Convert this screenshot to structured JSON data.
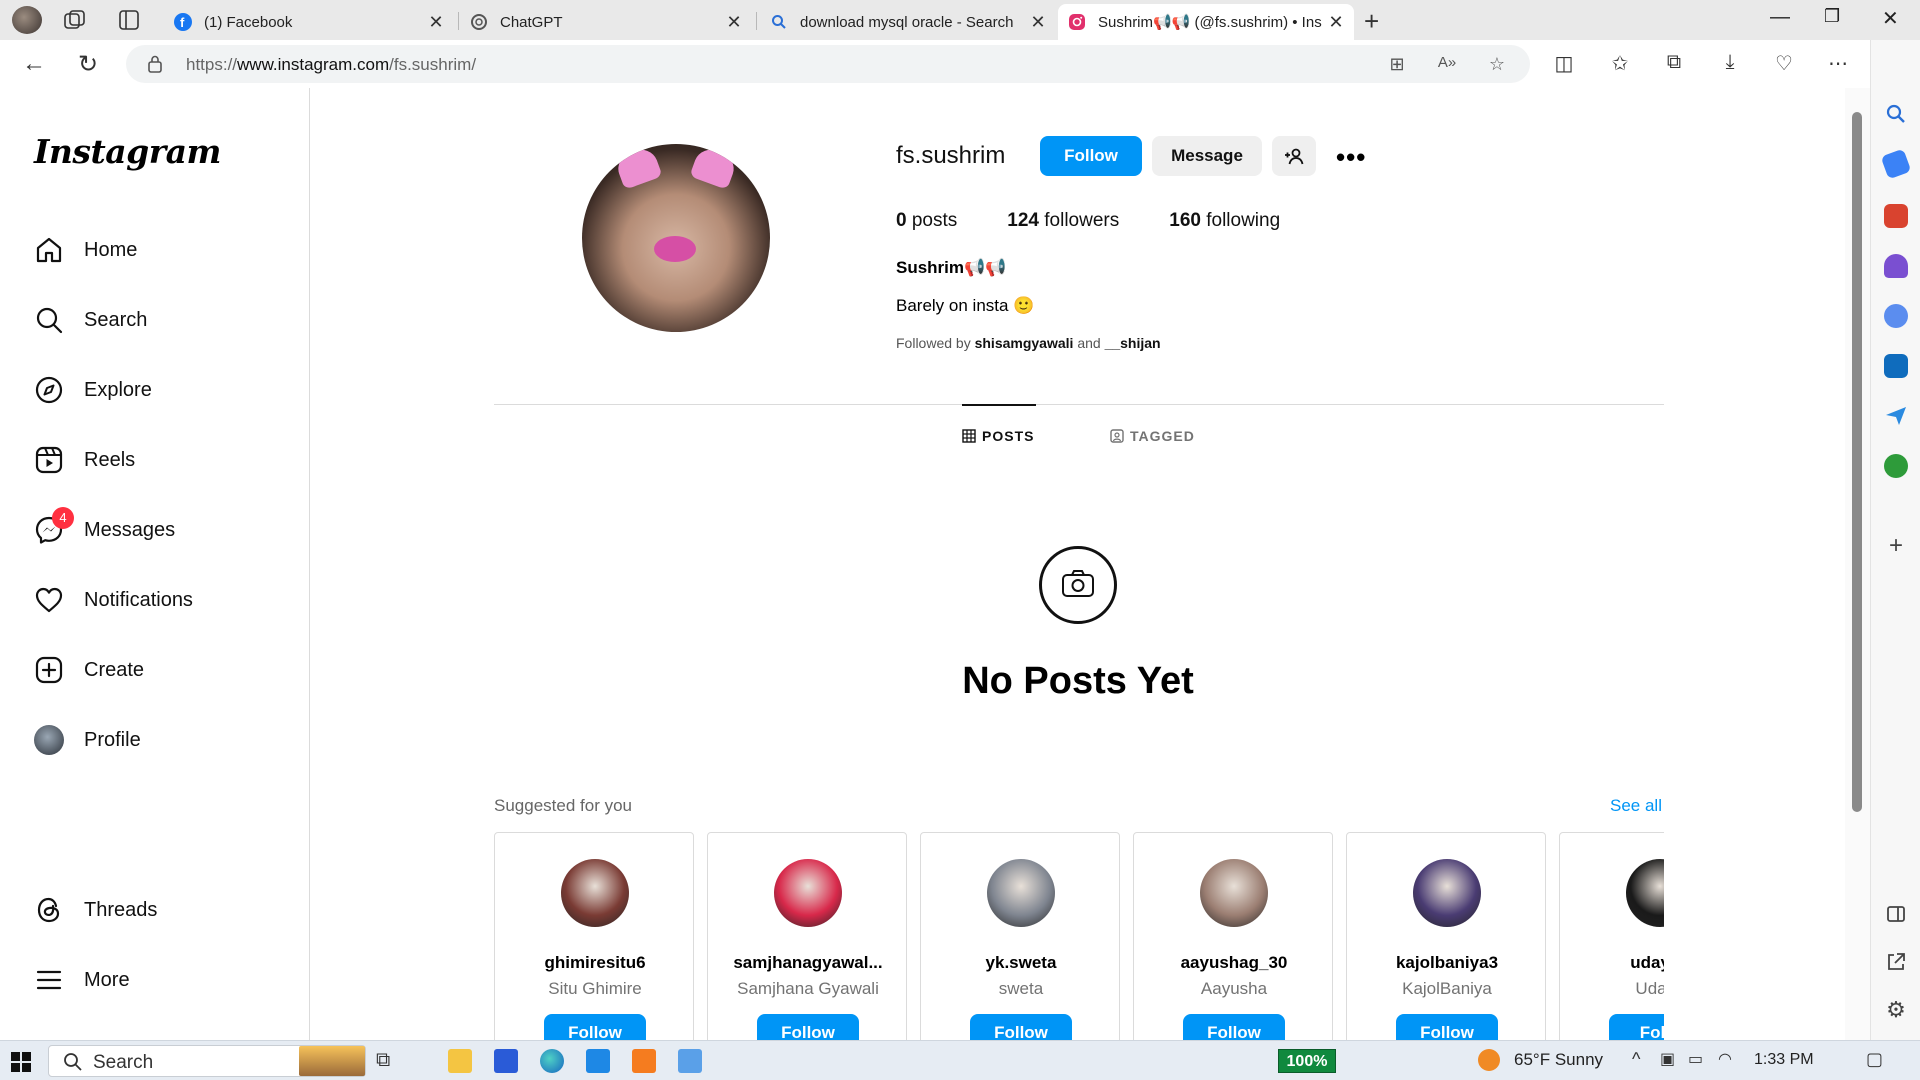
{
  "browser": {
    "tabs": [
      {
        "title": "(1) Facebook",
        "active": false
      },
      {
        "title": "ChatGPT",
        "active": false
      },
      {
        "title": "download mysql oracle - Search",
        "active": false
      },
      {
        "title": "Sushrim📢📢 (@fs.sushrim) • Ins",
        "active": true
      }
    ],
    "url_prefix": "https://",
    "url_domain": "www.instagram.com",
    "url_path": "/fs.sushrim/"
  },
  "sidebar": {
    "logo": "Instagram",
    "items": [
      {
        "label": "Home",
        "icon": "home-icon"
      },
      {
        "label": "Search",
        "icon": "search-icon"
      },
      {
        "label": "Explore",
        "icon": "compass-icon"
      },
      {
        "label": "Reels",
        "icon": "reels-icon"
      },
      {
        "label": "Messages",
        "icon": "messenger-icon",
        "badge": "4"
      },
      {
        "label": "Notifications",
        "icon": "heart-icon"
      },
      {
        "label": "Create",
        "icon": "plus-square-icon"
      },
      {
        "label": "Profile",
        "icon": "avatar"
      }
    ],
    "bottom": [
      {
        "label": "Threads",
        "icon": "threads-icon"
      },
      {
        "label": "More",
        "icon": "menu-icon"
      }
    ]
  },
  "profile": {
    "username": "fs.sushrim",
    "follow_label": "Follow",
    "message_label": "Message",
    "posts_count": "0",
    "posts_label": "posts",
    "followers_count": "124",
    "followers_label": "followers",
    "following_count": "160",
    "following_label": "following",
    "full_name": "Sushrim📢📢",
    "bio": "Barely on insta 🙂",
    "followed_by_prefix": "Followed by",
    "followed_by_user1": "shisamgyawali",
    "followed_by_and": "and",
    "followed_by_user2": "__shijan"
  },
  "profile_tabs": {
    "posts": "POSTS",
    "tagged": "TAGGED"
  },
  "empty_state": {
    "title": "No Posts Yet"
  },
  "suggestions": {
    "heading": "Suggested for you",
    "see_all": "See all",
    "cards": [
      {
        "username": "ghimiresitu6",
        "name": "Situ Ghimire",
        "follow": "Follow",
        "color": "#7a3b34"
      },
      {
        "username": "samjhanagyawal...",
        "name": "Samjhana Gyawali",
        "follow": "Follow",
        "color": "#d8284a"
      },
      {
        "username": "yk.sweta",
        "name": "sweta",
        "follow": "Follow",
        "color": "#7f8590"
      },
      {
        "username": "aayushag_30",
        "name": "Aayusha",
        "follow": "Follow",
        "color": "#9b7e72"
      },
      {
        "username": "kajolbaniya3",
        "name": "KajolBaniya",
        "follow": "Follow",
        "color": "#4a3c73"
      },
      {
        "username": "udaypa",
        "name": "Uday I",
        "follow": "Follo",
        "color": "#1a1a1a"
      }
    ]
  },
  "taskbar": {
    "search_label": "Search",
    "battery": "100%",
    "weather": "65°F  Sunny",
    "time": "1:33 PM"
  },
  "colors": {
    "accent": "#0095f6",
    "badge": "#ff3040"
  }
}
